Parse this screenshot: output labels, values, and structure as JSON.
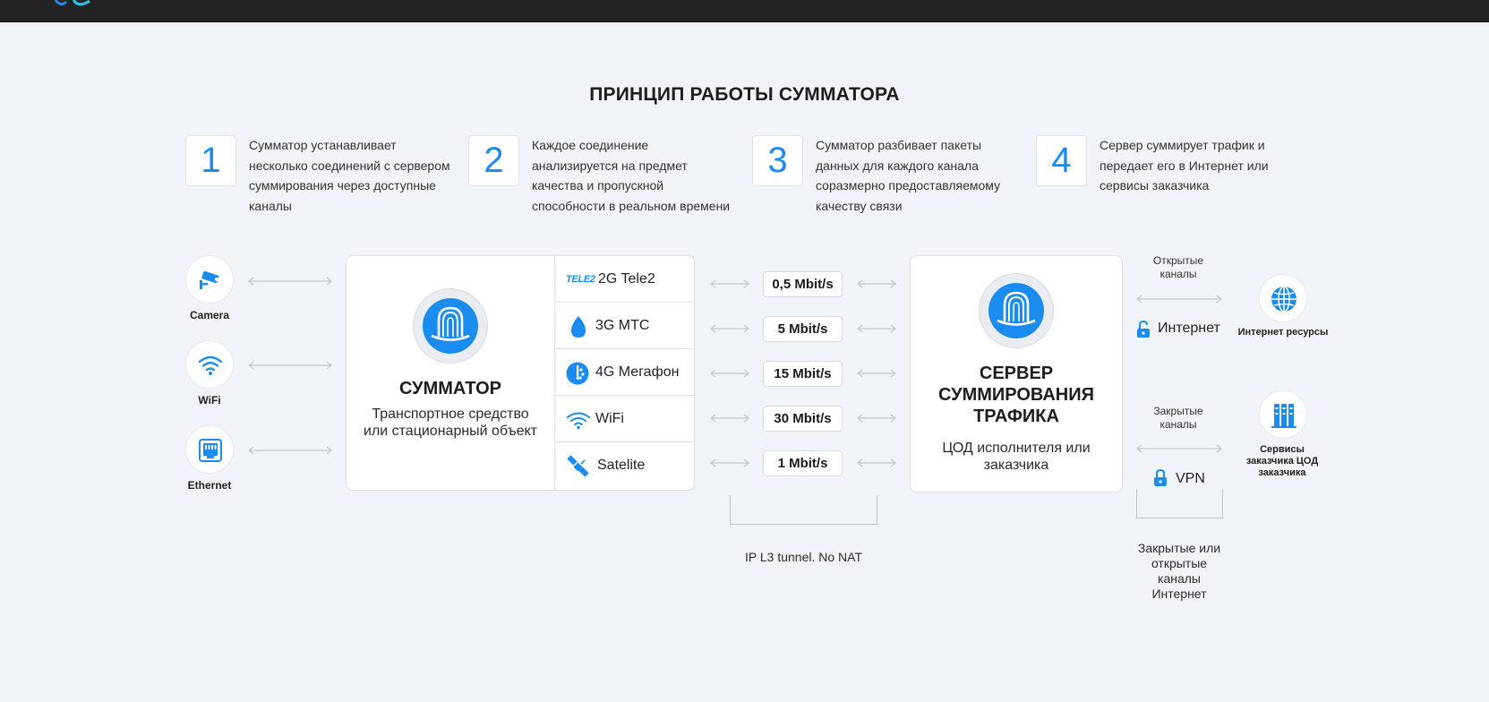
{
  "title": "ПРИНЦИП РАБОТЫ СУММАТОРА",
  "steps": [
    {
      "num": "1",
      "text": "Сумматор устанавливает несколько соединений с сервером суммирования через доступные каналы"
    },
    {
      "num": "2",
      "text": "Каждое соединение анализируется на предмет качества и пропускной способности в реальном времени"
    },
    {
      "num": "3",
      "text": "Сумматор разбивает пакеты данных для каждого канала соразмерно предоставляемому качеству связи"
    },
    {
      "num": "4",
      "text": "Сервер суммирует трафик и передает его в Интернет или сервисы заказчика"
    }
  ],
  "devices": [
    {
      "label": "Camera",
      "icon": "camera-icon"
    },
    {
      "label": "WiFi",
      "icon": "wifi-icon"
    },
    {
      "label": "Ethernet",
      "icon": "ethernet-icon"
    }
  ],
  "summator": {
    "title": "СУММАТОР",
    "subtitle_line1": "Транспортное средство",
    "subtitle_line2": "или стационарный объект"
  },
  "channels": [
    {
      "logo": "TELE2",
      "label": "2G Tele2",
      "icon": "tele2-icon"
    },
    {
      "label": "3G МТС",
      "icon": "mts-egg-icon"
    },
    {
      "label": "4G Мегафон",
      "icon": "megafon-icon"
    },
    {
      "label": "WiFi",
      "icon": "wifi-icon"
    },
    {
      "label": "Satelite",
      "icon": "satellite-icon"
    }
  ],
  "speeds": [
    "0,5 Mbit/s",
    "5 Mbit/s",
    "15 Mbit/s",
    "30 Mbit/s",
    "1 Mbit/s"
  ],
  "tunnel_label": "IP L3 tunnel. No NAT",
  "server": {
    "title_line1": "СЕРВЕР",
    "title_line2": "СУММИРОВАНИЯ",
    "title_line3": "ТРАФИКА",
    "subtitle_line1": "ЦОД исполнителя или",
    "subtitle_line2": "заказчика"
  },
  "open_channels": {
    "line1": "Открытые",
    "line2": "каналы",
    "label": "Интернет",
    "icon": "unlock-icon"
  },
  "closed_channels": {
    "line1": "Закрытые",
    "line2": "каналы",
    "label": "VPN",
    "icon": "lock-icon"
  },
  "destinations": [
    {
      "label": "Интернет ресурсы",
      "icon": "globe-icon"
    },
    {
      "line1": "Сервисы",
      "line2": "заказчика ЦОД",
      "line3": "заказчика",
      "icon": "server-rack-icon"
    }
  ],
  "footnote": {
    "line1": "Закрытые или",
    "line2": "открытые",
    "line3": "каналы",
    "line4": "Интернет"
  },
  "colors": {
    "accent": "#1a8cf0",
    "background": "#f0f3f7",
    "topbar": "#232323"
  }
}
